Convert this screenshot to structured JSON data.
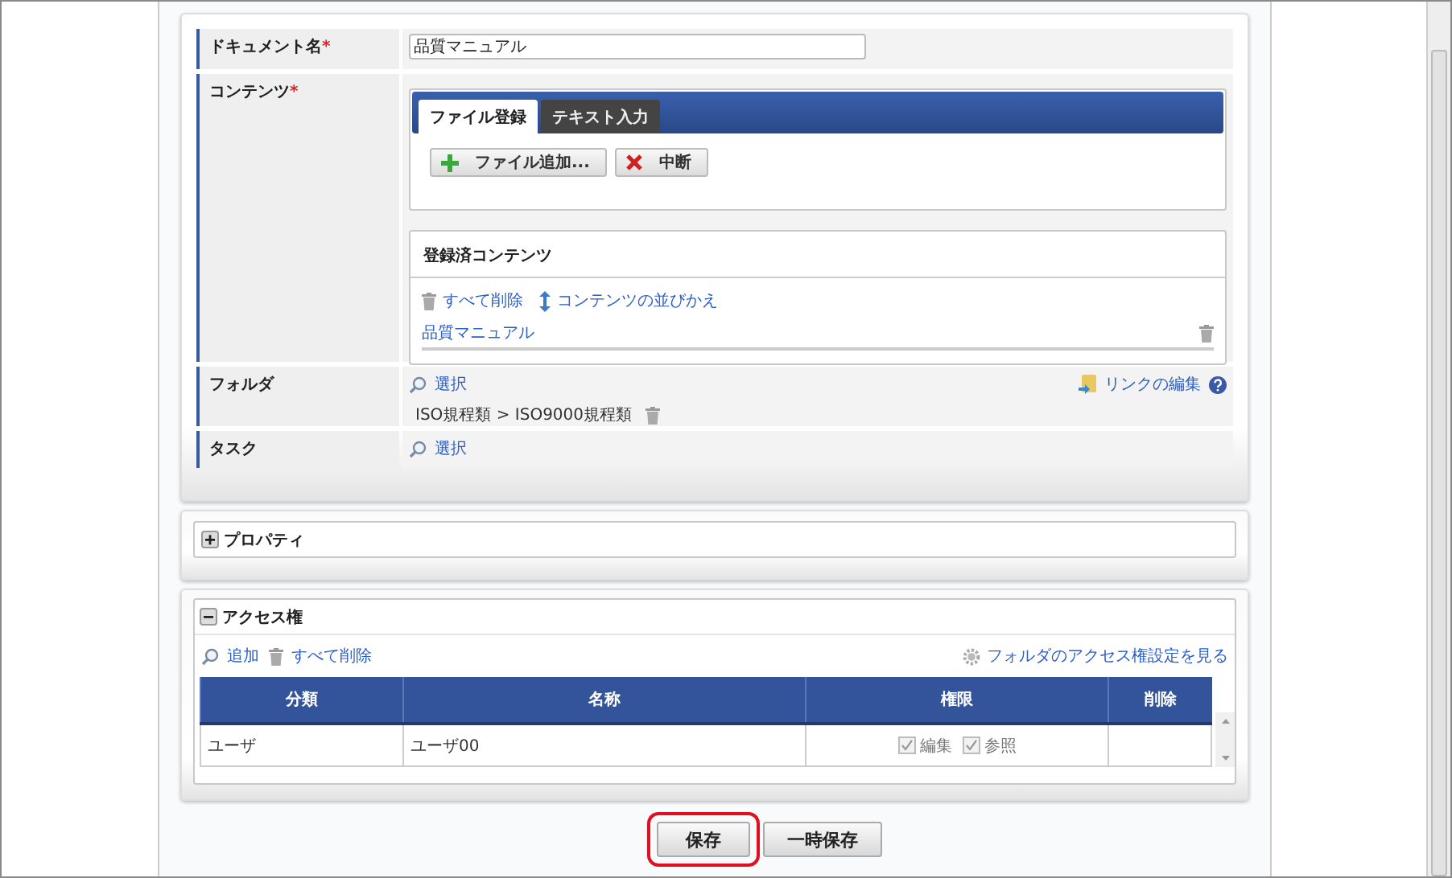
{
  "document_name": {
    "label": "ドキュメント名",
    "required": true,
    "required_mark": "*",
    "value": "品質マニュアル"
  },
  "contents": {
    "label": "コンテンツ",
    "required": true,
    "required_mark": "*",
    "tabs": [
      {
        "label": "ファイル登録",
        "selected": true
      },
      {
        "label": "テキスト入力",
        "selected": false
      }
    ],
    "buttons": [
      {
        "kind": "add",
        "label": "ファイル追加..."
      },
      {
        "kind": "cancel",
        "label": "中断"
      }
    ],
    "registered": {
      "title": "登録済コンテンツ",
      "actions": [
        {
          "kind": "delete",
          "label": "すべて削除"
        },
        {
          "kind": "sort",
          "label": "コンテンツの並びかえ"
        }
      ],
      "items": [
        "品質マニュアル"
      ]
    }
  },
  "folder": {
    "label": "フォルダ",
    "select": "選択",
    "link_edit": "リンクの編集",
    "path": "ISO規程類 > ISO9000規程類"
  },
  "task": {
    "label": "タスク",
    "select": "選択"
  },
  "properties": {
    "label": "プロパティ",
    "expanded": false
  },
  "access": {
    "label": "アクセス権",
    "expanded": true,
    "actions": [
      {
        "kind": "add",
        "label": "追加"
      },
      {
        "kind": "delete",
        "label": "すべて削除"
      }
    ],
    "folder_link": "フォルダのアクセス権設定を見る",
    "columns": [
      "分類",
      "名称",
      "権限",
      "削除"
    ],
    "rows": [
      {
        "type": "ユーザ",
        "name": "ユーザ00",
        "permissions": [
          {
            "label": "編集",
            "checked": true,
            "disabled": true
          },
          {
            "label": "参照",
            "checked": true,
            "disabled": true
          }
        ]
      }
    ]
  },
  "buttons": [
    {
      "label": "保存",
      "highlighted": true
    },
    {
      "label": "一時保存",
      "highlighted": false
    }
  ]
}
